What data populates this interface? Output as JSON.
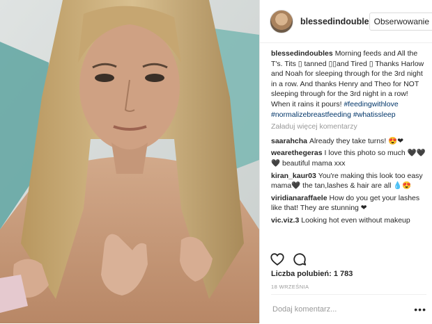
{
  "post": {
    "username": "blessedindouble",
    "follow_label": "Obserwowanie"
  },
  "comments": [
    {
      "user": "blessedindoubles",
      "text_before": "Morning feeds and All the T's. Tits ▯ tanned ▯▯and Tired ▯ Thanks Harlow and Noah for sleeping through for the 3rd night in a row. And thanks Henry and Theo for NOT sleeping through for the 3rd night in a row! When it rains it pours! ",
      "hashtags": "#feedingwithlove #normalizebreastfeeding #whatissleep"
    }
  ],
  "load_more_label": "Załaduj więcej komentarzy",
  "replies": [
    {
      "user": "saarahcha",
      "text": "Already they take turns! 😍❤"
    },
    {
      "user": "wearethegeras",
      "text": "I love this photo so much 🖤🖤🖤 beautiful mama xxx"
    },
    {
      "user": "kiran_kaur03",
      "text": "You're making this look too easy mama🖤 the tan,lashes & hair are all 💧😍"
    },
    {
      "user": "viridianaraffaele",
      "text": "How do you get your lashes like that! They are stunning ❤"
    },
    {
      "user": "vic.viz.3",
      "text": "Looking hot even without makeup"
    }
  ],
  "likes_label": "Liczba polubień: 1 783",
  "date_label": "18 WRZEŚNIA",
  "comment_placeholder": "Dodaj komentarz...",
  "more_options": "•••",
  "icons": {
    "like": "heart-icon",
    "comment": "comment-bubble-icon",
    "more": "more-options-icon"
  }
}
